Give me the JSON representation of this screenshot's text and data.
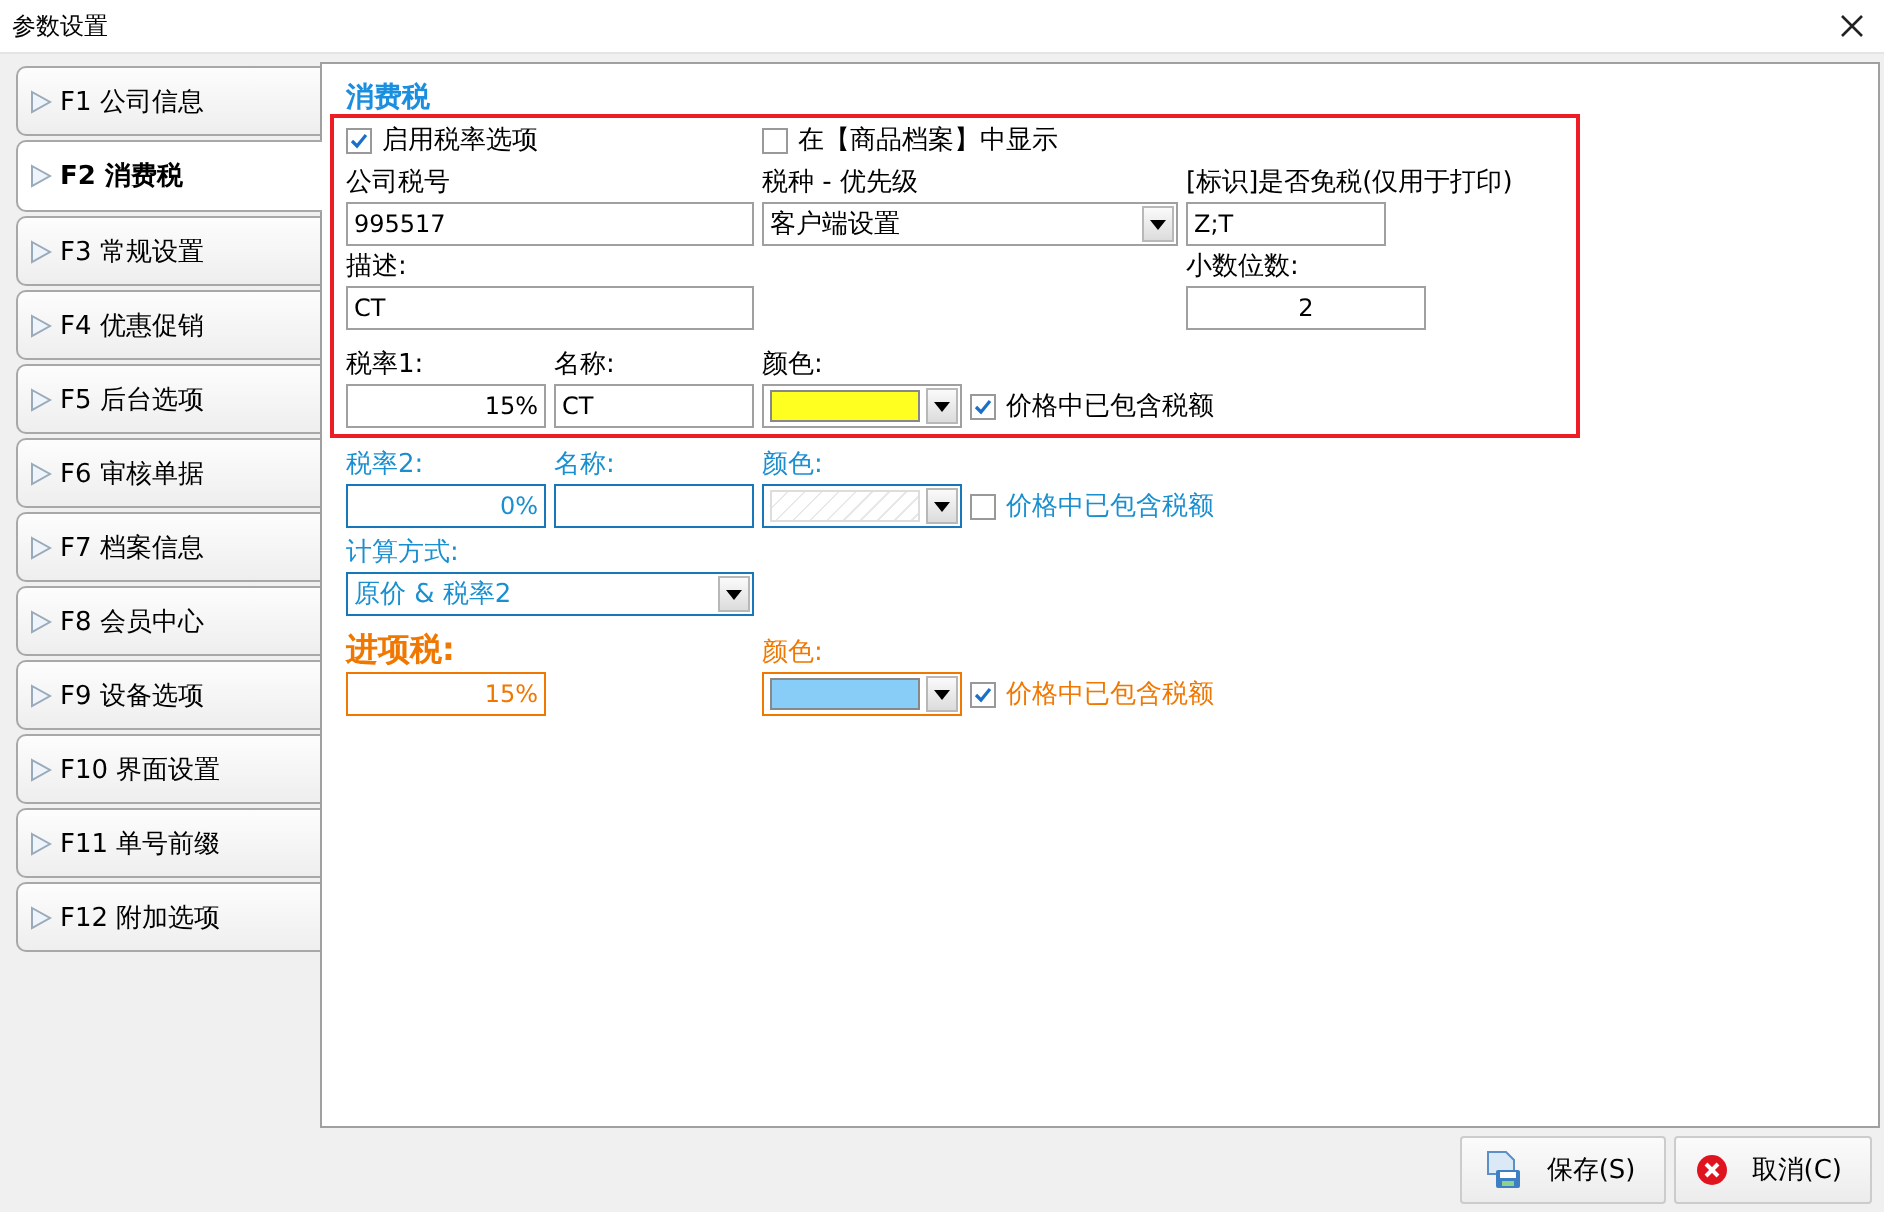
{
  "window": {
    "title": "参数设置"
  },
  "tabs": [
    {
      "label": "F1 公司信息",
      "selected": false
    },
    {
      "label": "F2 消费税",
      "selected": true
    },
    {
      "label": "F3 常规设置",
      "selected": false
    },
    {
      "label": "F4 优惠促销",
      "selected": false
    },
    {
      "label": "F5 后台选项",
      "selected": false
    },
    {
      "label": "F6 审核单据",
      "selected": false
    },
    {
      "label": "F7 档案信息",
      "selected": false
    },
    {
      "label": "F8 会员中心",
      "selected": false
    },
    {
      "label": "F9 设备选项",
      "selected": false
    },
    {
      "label": "F10 界面设置",
      "selected": false
    },
    {
      "label": "F11 单号前缀",
      "selected": false
    },
    {
      "label": "F12 附加选项",
      "selected": false
    }
  ],
  "section_title": "消费税",
  "enable_rates": {
    "label": "启用税率选项",
    "checked": true
  },
  "show_in_catalog": {
    "label": "在【商品档案】中显示",
    "checked": false
  },
  "company_tax_id": {
    "label": "公司税号",
    "value": "995517"
  },
  "tax_type": {
    "label": "税种 - 优先级",
    "value": "客户端设置"
  },
  "exempt_mark": {
    "label": "[标识]是否免税(仅用于打印)",
    "value": "Z;T"
  },
  "description": {
    "label": "描述:",
    "value": "CT"
  },
  "decimals": {
    "label": "小数位数:",
    "value": "2"
  },
  "rates": [
    {
      "kind": "normal",
      "rate_label": "税率1:",
      "rate": "15%",
      "name_label": "名称:",
      "name": "CT",
      "color_label": "颜色:",
      "color": "#ffff20",
      "included": {
        "label": "价格中已包含税额",
        "checked": true
      }
    },
    {
      "kind": "blue",
      "rate_label": "税率2:",
      "rate": "0%",
      "name_label": "名称:",
      "color_label": "颜色:",
      "included": {
        "label": "价格中已包含税额",
        "checked": false
      }
    }
  ],
  "calc_method": {
    "label": "计算方式:",
    "value": "原价 & 税率2"
  },
  "input_tax": {
    "title": "进项税:",
    "rate": "15%",
    "color_label": "颜色:",
    "color": "#88ccf8",
    "included": {
      "label": "价格中已包含税额",
      "checked": true
    }
  },
  "buttons": [
    {
      "kind": "save",
      "label": "保存(S)"
    },
    {
      "kind": "cancel",
      "label": "取消(C)"
    }
  ]
}
